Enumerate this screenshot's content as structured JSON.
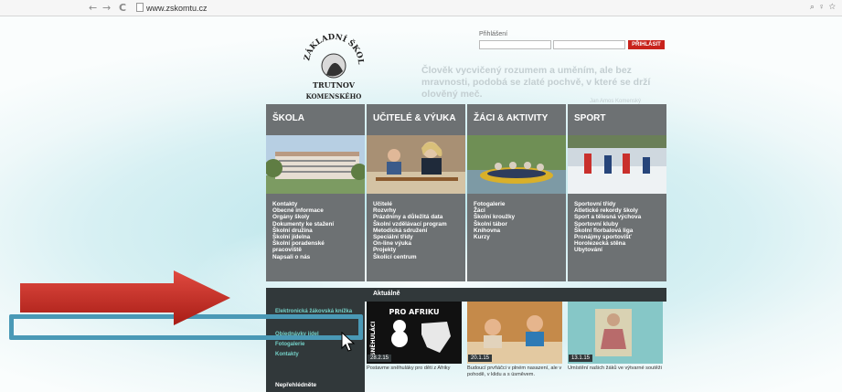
{
  "browser": {
    "url": "www.zskomtu.cz"
  },
  "header": {
    "login_label": "Přihlášení",
    "login_button": "PŘIHLÁSIT",
    "quote": "Člověk vycvičený rozumem a uměním, ale bez mravnosti, podobá se zlaté pochvě, v které se drží olověný meč.",
    "quote_author": "Jan Amos Komenský"
  },
  "logo": {
    "line1": "ZÁKLADNÍ ŠKOLA",
    "line2": "TRUTNOV",
    "line3": "KOMENSKÉHO"
  },
  "columns": [
    {
      "title": "ŠKOLA",
      "items": [
        "Kontakty",
        "Obecné informace",
        "Orgány školy",
        "Dokumenty ke stažení",
        "Školní družina",
        "Školní jídelna",
        "Školní poradenské",
        "pracoviště",
        "Napsali o nás"
      ]
    },
    {
      "title": "UČITELÉ & VÝUKA",
      "items": [
        "Učitelé",
        "Rozvrhy",
        "Prázdniny a důležitá data",
        "Školní vzdělávací program",
        "Metodická sdružení",
        "Speciální třídy",
        "On-line výuka",
        "Projekty",
        "Školící centrum"
      ]
    },
    {
      "title": "ŽÁCI & AKTIVITY",
      "items": [
        "Fotogalerie",
        "Žáci",
        "Školní kroužky",
        "Školní tábor",
        "Knihovna",
        "Kurzy"
      ]
    },
    {
      "title": "SPORT",
      "items": [
        "Sportovní třídy",
        "Atletické rekordy školy",
        "Sport a tělesná výchova",
        "Sportovní kluby",
        "Školní florbalová liga",
        "Pronájmy sportovišť",
        "Horolezecká stěna",
        "Ubytování"
      ]
    }
  ],
  "quicklinks": {
    "items": [
      "Elektronická žákovská knížka",
      "Objednávky jídel",
      "Fotogalerie",
      "Kontakty"
    ],
    "heading": "Nepřehlédněte"
  },
  "news": {
    "heading": "Aktuálně",
    "items": [
      {
        "date": "28.2.15",
        "text": "Postavme sněhuláky pro děti z Afriky",
        "banner": "PRO AFRIKU",
        "side": "SNĚHULÁCI"
      },
      {
        "date": "20.1.15",
        "text": "Budoucí prvňáčci v plném nasazení, ale v pohodě, v klidu a s úsměvem."
      },
      {
        "date": "13.1.15",
        "text": "Umístění našich žáků ve výtvarné soutěži"
      }
    ]
  },
  "colors": {
    "accent": "#c8231c",
    "column_bg": "#6d7173",
    "panel_bg": "#31383a",
    "highlight": "#4a99b6",
    "arrow": "#c8231c"
  }
}
